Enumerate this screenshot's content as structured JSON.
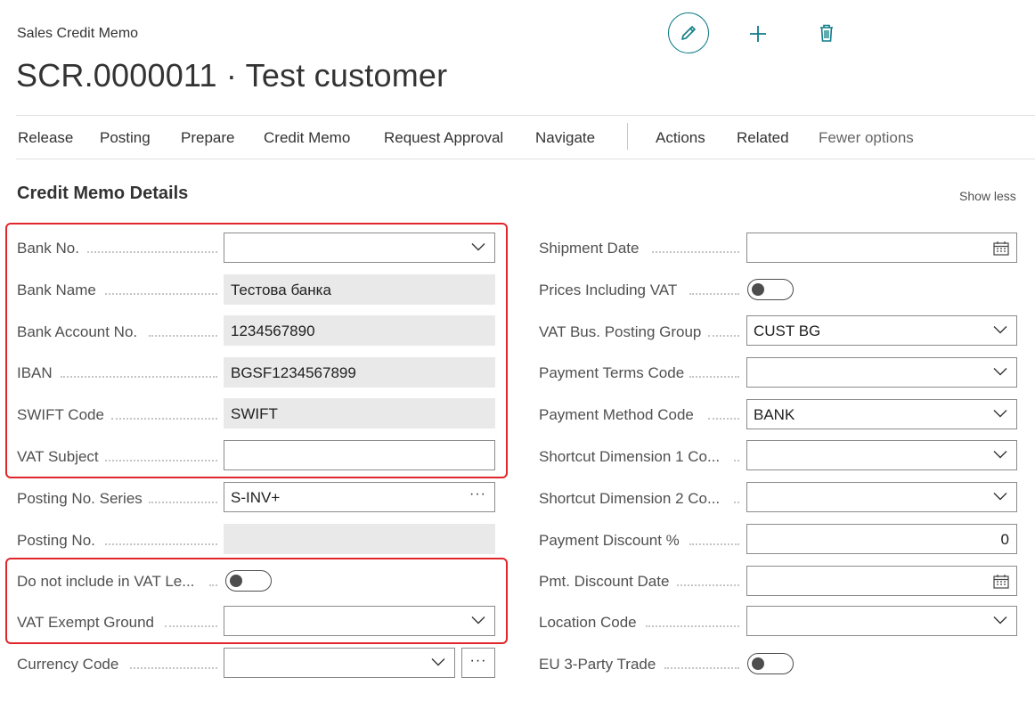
{
  "header": {
    "page_type": "Sales Credit Memo",
    "title": "SCR.0000011 · Test customer",
    "icons": {
      "edit": "pencil-icon",
      "new": "plus-icon",
      "delete": "trash-icon"
    },
    "accent_color": "#0e7c86"
  },
  "action_bar": {
    "items": [
      "Release",
      "Posting",
      "Prepare",
      "Credit Memo",
      "Request Approval",
      "Navigate"
    ],
    "secondary": [
      "Actions",
      "Related"
    ],
    "fewer_options": "Fewer options"
  },
  "section": {
    "title": "Credit Memo Details",
    "toggle_label": "Show less"
  },
  "left_fields": [
    {
      "label": "Bank No.",
      "value": "",
      "kind": "dropdown"
    },
    {
      "label": "Bank Name",
      "value": "Тестова банка",
      "kind": "readonly"
    },
    {
      "label": "Bank Account No.",
      "value": "1234567890",
      "kind": "readonly"
    },
    {
      "label": "IBAN",
      "value": "BGSF1234567899",
      "kind": "readonly"
    },
    {
      "label": "SWIFT Code",
      "value": "SWIFT",
      "kind": "readonly"
    },
    {
      "label": "VAT Subject",
      "value": "",
      "kind": "text"
    },
    {
      "label": "Posting No. Series",
      "value": "S-INV+",
      "kind": "lookup"
    },
    {
      "label": "Posting No.",
      "value": "",
      "kind": "readonly"
    },
    {
      "label": "Do not include in VAT Le...",
      "value": "off",
      "kind": "toggle"
    },
    {
      "label": "VAT Exempt Ground",
      "value": "",
      "kind": "dropdown"
    },
    {
      "label": "Currency Code",
      "value": "",
      "kind": "dropdown-lookup"
    }
  ],
  "right_fields": [
    {
      "label": "Shipment Date",
      "value": "",
      "kind": "date"
    },
    {
      "label": "Prices Including VAT",
      "value": "off",
      "kind": "toggle"
    },
    {
      "label": "VAT Bus. Posting Group",
      "value": "CUST BG",
      "kind": "dropdown"
    },
    {
      "label": "Payment Terms Code",
      "value": "",
      "kind": "dropdown"
    },
    {
      "label": "Payment Method Code",
      "value": "BANK",
      "kind": "dropdown"
    },
    {
      "label": "Shortcut Dimension 1 Co...",
      "value": "",
      "kind": "dropdown"
    },
    {
      "label": "Shortcut Dimension 2 Co...",
      "value": "",
      "kind": "dropdown"
    },
    {
      "label": "Payment Discount %",
      "value": "0",
      "kind": "number"
    },
    {
      "label": "Pmt. Discount Date",
      "value": "",
      "kind": "date"
    },
    {
      "label": "Location Code",
      "value": "",
      "kind": "dropdown"
    },
    {
      "label": "EU 3-Party Trade",
      "value": "off",
      "kind": "toggle"
    }
  ],
  "lookup_glyph": "···",
  "highlight_color": "#e0262a"
}
